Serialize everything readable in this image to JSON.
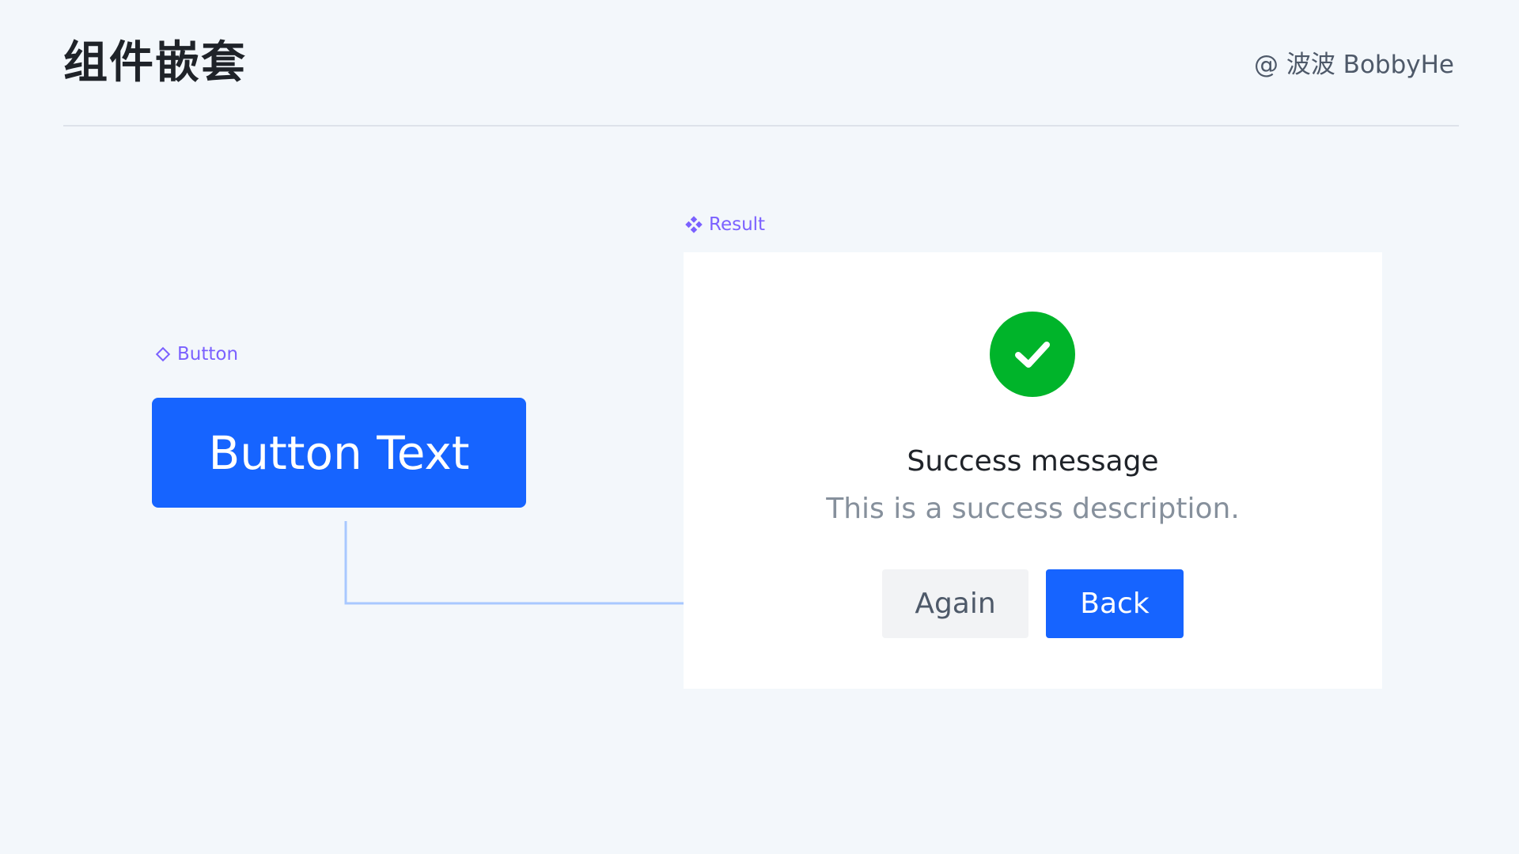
{
  "header": {
    "title": "组件嵌套",
    "author": "@ 波波 BobbyHe"
  },
  "labels": {
    "button_component": "Button",
    "result_component": "Result"
  },
  "button": {
    "text": "Button Text"
  },
  "result": {
    "title": "Success message",
    "description": "This is a success description.",
    "again_label": "Again",
    "back_label": "Back"
  },
  "icons": {
    "button_component_icon": "diamond-outline-icon",
    "result_component_icon": "four-diamonds-icon",
    "status_icon": "check-circle-icon",
    "connector": "arrow-right-icon"
  },
  "colors": {
    "background": "#f3f7fb",
    "primary": "#1664ff",
    "success": "#00b42a",
    "component_label": "#7b61ff",
    "connector": "#a8c8ff"
  }
}
